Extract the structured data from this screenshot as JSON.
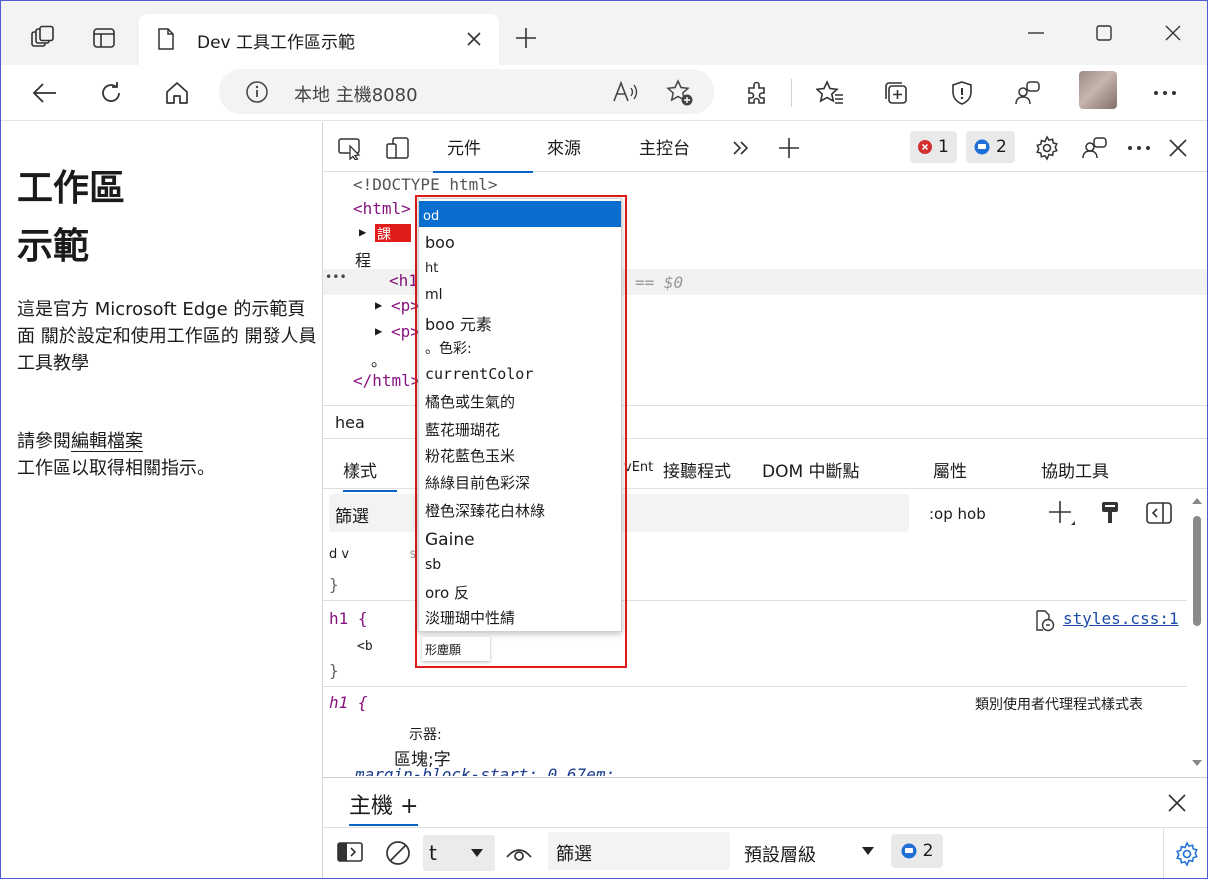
{
  "browser": {
    "tab_title": "Dev 工具工作區示範",
    "address": "本地 主機8080"
  },
  "page": {
    "heading": "工作區\n示範",
    "para1": "這是官方 Microsoft Edge 的示範頁面 關於設定和使用工作區的 開發人員工具教學",
    "para2_prefix": "請參閱",
    "para2_link": "編輯檔案",
    "para2_suffix": "工作區以取得相關指示。"
  },
  "devtools": {
    "tabs": [
      "元件",
      "來源",
      "主控台"
    ],
    "errors_count": "1",
    "messages_count": "2",
    "dom_lines": {
      "doctype": "<!DOCTYPE html>",
      "html_open": "<html>",
      "body_marker": "課",
      "body_text": "程",
      "h1_open": "<h1",
      "selected_suffix": "== $0",
      "p1": "<p>",
      "p2": "<p>",
      "dot": "。",
      "html_close": "</html>",
      "ellipsis": "•••"
    },
    "breadcrumb": "hea",
    "subtabs": {
      "styles": "樣式",
      "event": "vEnt",
      "listeners": "接聽程式",
      "dom_breakpoints": "DOM 中斷點",
      "properties": "屬性",
      "accessibility": "協助工具"
    },
    "filter_placeholder": "篩選",
    "hov_label": ":op hob",
    "rules": {
      "element_label": "d v",
      "close_brace": "}",
      "h1_selector": "h1 {",
      "h1_prop": "<b",
      "h1_source": "styles.css:1",
      "ua_selector": "h1 {",
      "ua_label": "類別使用者代理程式樣式表",
      "ua_prop1": "示器:",
      "ua_prop2": "區塊;字",
      "ua_prop3": "margin-block-start: 0.67em;"
    },
    "autocomplete": {
      "items": [
        "od",
        "boo",
        "ht",
        "ml",
        "boo 元素",
        "。色彩:",
        "currentColor",
        "橘色或生氣的",
        "藍花珊瑚花",
        "粉花藍色玉米",
        "絲綠目前色彩深",
        "橙色深臻花白林綠",
        "Gaine",
        "sb",
        "oro 反",
        "淡珊瑚中性綪"
      ],
      "tooltip": "形塵願"
    },
    "drawer": {
      "title": "主機 +",
      "context": "t",
      "filter": "篩選",
      "levels": "預設層級",
      "issues_count": "2"
    }
  },
  "colors": {
    "accent": "#0a64c8",
    "error": "#d32f2f",
    "highlight_border": "#e01b1b",
    "tag": "#881280"
  }
}
